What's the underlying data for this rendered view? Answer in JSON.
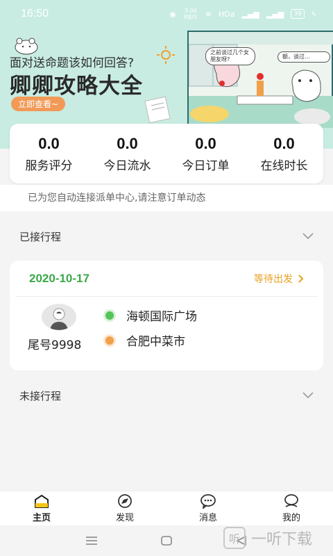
{
  "status_bar": {
    "time": "16:50",
    "network_speed": "3.00 KB/S",
    "hd_label": "HDa",
    "battery": "39"
  },
  "banner": {
    "subtitle": "面对送命题该如何回答?",
    "title": "卿卿攻略大全",
    "cta": "立即查看~",
    "bubble_left": "之前谈过几个女朋友呀?",
    "bubble_right": "额，谈过…"
  },
  "stats": [
    {
      "value": "0.0",
      "label": "服务评分"
    },
    {
      "value": "0.0",
      "label": "今日流水"
    },
    {
      "value": "0.0",
      "label": "今日订单"
    },
    {
      "value": "0.0",
      "label": "在线时长"
    }
  ],
  "notice": "已为您自动连接派单中心,请注意订单动态",
  "accepted": {
    "title": "已接行程",
    "trip": {
      "date": "2020-10-17",
      "status": "等待出发",
      "tail": "尾号9998",
      "from": "海顿国际广场",
      "to": "合肥中菜市"
    }
  },
  "pending": {
    "title": "未接行程"
  },
  "nav": [
    {
      "label": "主页",
      "icon": "home-icon"
    },
    {
      "label": "发现",
      "icon": "discover-icon"
    },
    {
      "label": "消息",
      "icon": "message-icon"
    },
    {
      "label": "我的",
      "icon": "profile-icon"
    }
  ],
  "watermark": {
    "logo": "听",
    "text": "一听下载"
  },
  "colors": {
    "banner_bg": "#c8ece2",
    "trip_date": "#3aa848",
    "trip_status": "#e8a020",
    "cta": "#f19a57",
    "dot_from": "#56c45a",
    "dot_to": "#f0a04a"
  }
}
